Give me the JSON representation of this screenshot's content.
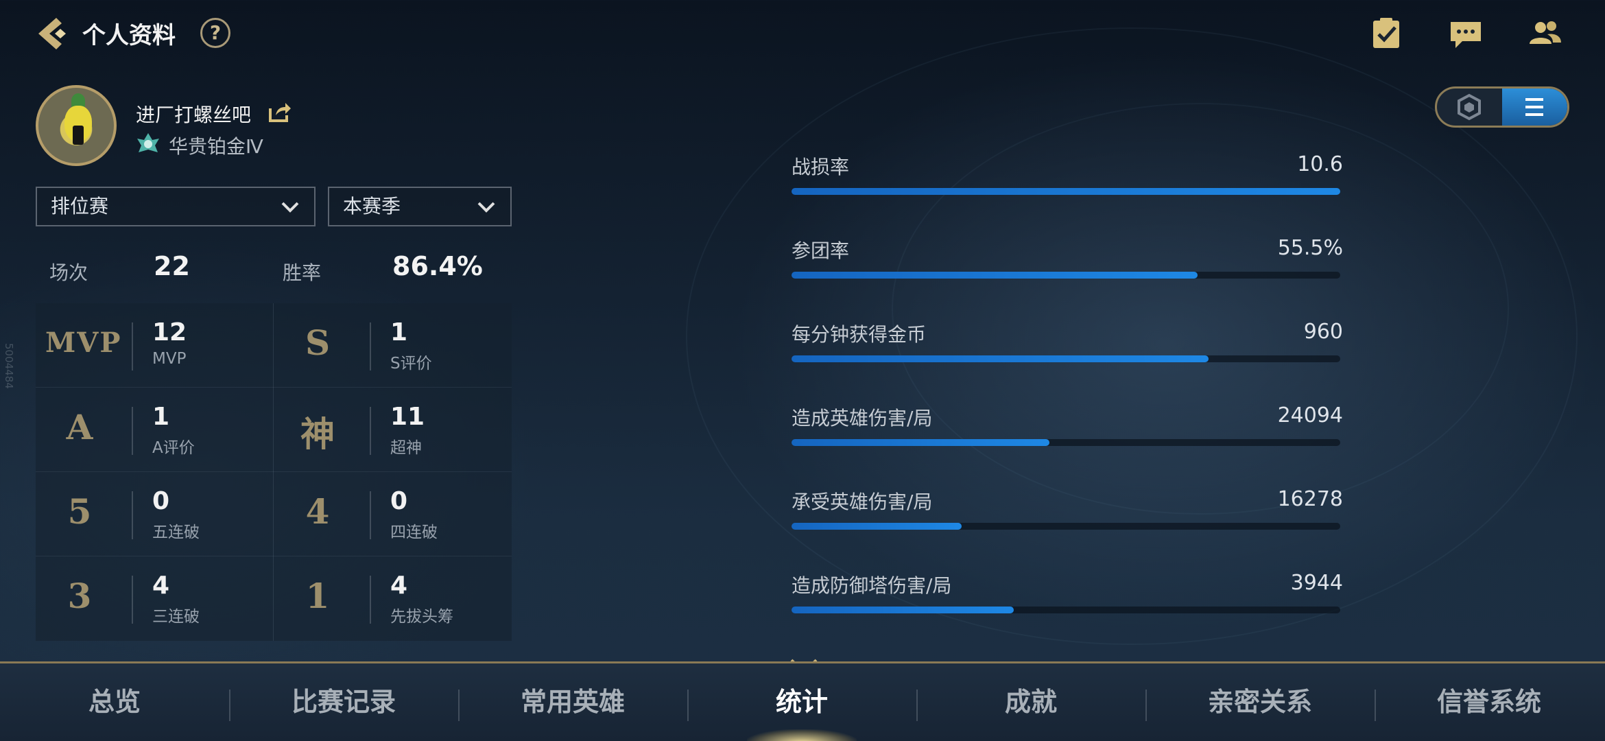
{
  "header": {
    "title": "个人资料",
    "help_label": "?"
  },
  "profile": {
    "nickname": "进厂打螺丝吧",
    "rank": "华贵铂金Ⅳ"
  },
  "filters": {
    "mode": "排位赛",
    "season": "本赛季"
  },
  "summary": {
    "games_label": "场次",
    "games_value": "22",
    "winrate_label": "胜率",
    "winrate_value": "86.4%"
  },
  "stats_grid": [
    {
      "glyph": "MVP",
      "value": "12",
      "label": "MVP"
    },
    {
      "glyph": "S",
      "value": "1",
      "label": "S评价"
    },
    {
      "glyph": "A",
      "value": "1",
      "label": "A评价"
    },
    {
      "glyph": "神",
      "value": "11",
      "label": "超神"
    },
    {
      "glyph": "5",
      "value": "0",
      "label": "五连破"
    },
    {
      "glyph": "4",
      "value": "0",
      "label": "四连破"
    },
    {
      "glyph": "3",
      "value": "4",
      "label": "三连破"
    },
    {
      "glyph": "1",
      "value": "4",
      "label": "先拔头筹"
    }
  ],
  "bars": [
    {
      "name": "战损率",
      "value": "10.6",
      "fill": 1.0
    },
    {
      "name": "参团率",
      "value": "55.5%",
      "fill": 0.74
    },
    {
      "name": "每分钟获得金币",
      "value": "960",
      "fill": 0.76
    },
    {
      "name": "造成英雄伤害/局",
      "value": "24094",
      "fill": 0.47
    },
    {
      "name": "承受英雄伤害/局",
      "value": "16278",
      "fill": 0.31
    },
    {
      "name": "造成防御塔伤害/局",
      "value": "3944",
      "fill": 0.405
    }
  ],
  "tabs": [
    "总览",
    "比赛记录",
    "常用英雄",
    "统计",
    "成就",
    "亲密关系",
    "信誉系统"
  ],
  "active_tab": 3,
  "watermark": "5004484",
  "colors": {
    "accent_gold": "#b59d69",
    "bar_blue": "#1e88e5",
    "toggle_active": "#2c8ed8"
  },
  "icons": {
    "back": "back-arrow-icon",
    "tasks": "checklist-icon",
    "chat": "chat-bubble-icon",
    "friends": "friends-icon",
    "share": "share-icon",
    "rank": "platinum-rank-icon",
    "toggle_left": "hexagon-icon",
    "toggle_right": "list-icon"
  }
}
